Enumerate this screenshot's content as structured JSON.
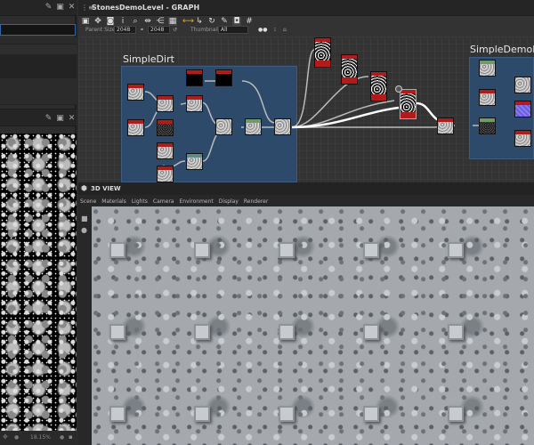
{
  "graph": {
    "title": "StonesDemoLevel - GRAPH",
    "toolbar": {
      "parent_size_label": "Parent Size:",
      "parent_size_w": "2048",
      "parent_size_h": "2048",
      "thumbnails_label": "Thumbnails:",
      "thumbnails_value": "All"
    },
    "frames": [
      {
        "title": "SimpleDirt"
      },
      {
        "title": "SimpleDemoMa"
      }
    ]
  },
  "view3d": {
    "title": "3D VIEW",
    "menu": [
      "Scene",
      "Materials",
      "Lights",
      "Camera",
      "Environment",
      "Display",
      "Renderer"
    ]
  },
  "view2d": {
    "zoom": "18.15%"
  }
}
